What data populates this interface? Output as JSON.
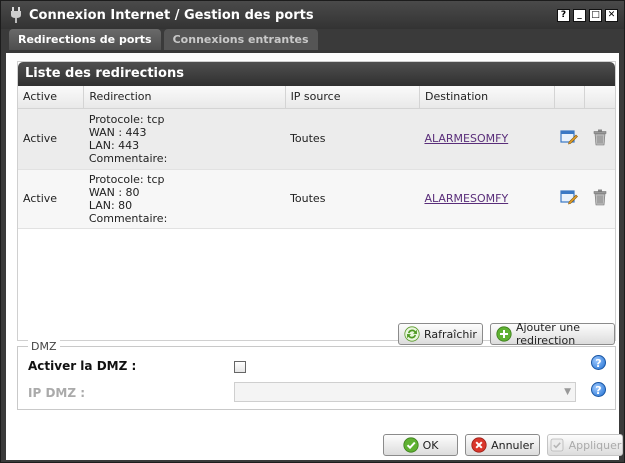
{
  "window": {
    "title": "Connexion Internet / Gestion des ports",
    "controls": [
      "?",
      "_",
      "□",
      "✕"
    ]
  },
  "tabs": [
    {
      "label": "Redirections de ports",
      "active": true
    },
    {
      "label": "Connexions entrantes",
      "active": false
    }
  ],
  "redirections": {
    "header": "Liste des redirections",
    "columns": [
      "Active",
      "Redirection",
      "IP source",
      "Destination"
    ],
    "rows": [
      {
        "active": "Active",
        "protocol": "Protocole: tcp",
        "wan": "WAN : 443",
        "lan": "LAN: 443",
        "comment": "Commentaire:",
        "ip_source": "Toutes",
        "destination": "ALARMESOMFY"
      },
      {
        "active": "Active",
        "protocol": "Protocole: tcp",
        "wan": "WAN : 80",
        "lan": "LAN: 80",
        "comment": "Commentaire:",
        "ip_source": "Toutes",
        "destination": "ALARMESOMFY"
      }
    ],
    "refresh_label": "Rafraîchir",
    "add_label": "Ajouter une redirection"
  },
  "dmz": {
    "legend": "DMZ",
    "enable_label": "Activer la DMZ :",
    "ip_label": "IP DMZ :",
    "help": "?"
  },
  "footer": {
    "ok_label": "OK",
    "cancel_label": "Annuler",
    "apply_label": "Appliquer"
  }
}
